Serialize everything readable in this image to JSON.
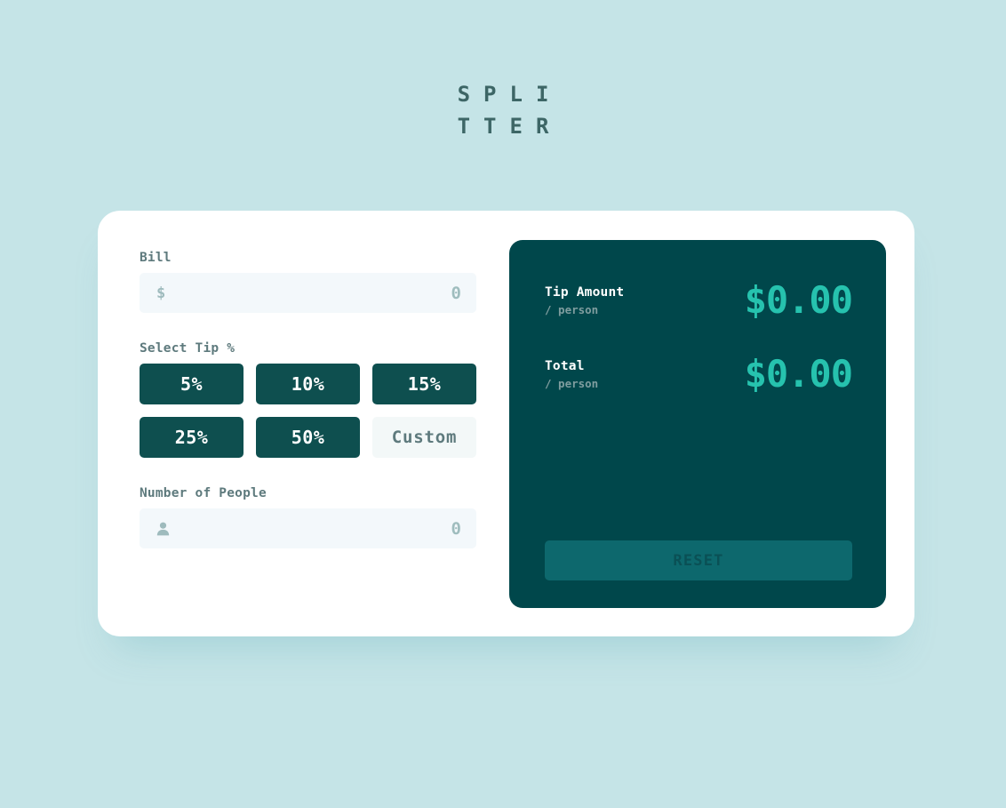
{
  "app": {
    "title_line1": "SPLI",
    "title_line2": "TTER",
    "title_full": "SPLITTER"
  },
  "colors": {
    "background": "#C5E4E7",
    "card": "#FFFFFF",
    "panel_dark": "#00474B",
    "accent_mint": "#26C2AE",
    "button_dark": "#0E4F4F",
    "input_bg": "#F3F8FB",
    "label_gray": "#5E7A7D",
    "reset_bg": "#0D686D",
    "reset_text": "#0A5055"
  },
  "bill": {
    "label": "Bill",
    "icon": "dollar-icon",
    "icon_glyph": "$",
    "value": "0",
    "placeholder": "0"
  },
  "tip": {
    "label": "Select Tip %",
    "options": [
      {
        "label": "5%",
        "value": 5,
        "selected": false,
        "custom": false
      },
      {
        "label": "10%",
        "value": 10,
        "selected": false,
        "custom": false
      },
      {
        "label": "15%",
        "value": 15,
        "selected": false,
        "custom": false
      },
      {
        "label": "25%",
        "value": 25,
        "selected": false,
        "custom": false
      },
      {
        "label": "50%",
        "value": 50,
        "selected": false,
        "custom": false
      },
      {
        "label": "Custom",
        "value": null,
        "selected": false,
        "custom": true
      }
    ]
  },
  "people": {
    "label": "Number of People",
    "icon": "person-icon",
    "value": "0",
    "placeholder": "0"
  },
  "results": {
    "rows": [
      {
        "label": "Tip Amount",
        "sub_label": "/ person",
        "value": "$0.00"
      },
      {
        "label": "Total",
        "sub_label": "/ person",
        "value": "$0.00"
      }
    ],
    "reset_label": "RESET",
    "reset_disabled": true
  }
}
